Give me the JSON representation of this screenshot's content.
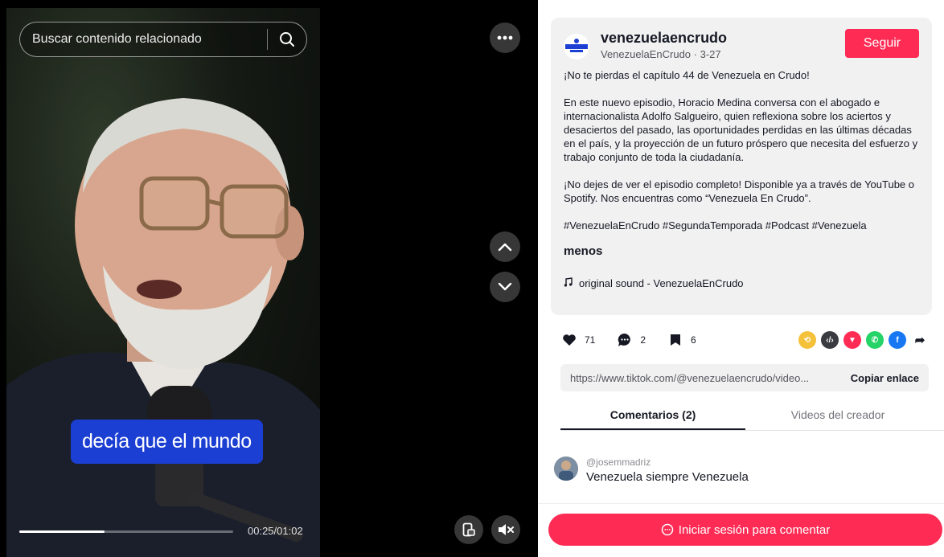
{
  "video": {
    "search_placeholder": "Buscar contenido relacionado",
    "caption": "decía que el mundo",
    "time": "00:25/01:02",
    "progress": 0.4
  },
  "creator": {
    "name": "venezuelaencrudo",
    "meta": "VenezuelaEnCrudo · 3-27",
    "follow_label": "Seguir",
    "avatar_text": "VENEZUELA EN CRUDO"
  },
  "description": {
    "p1": "¡No te pierdas el capítulo 44 de Venezuela en Crudo!",
    "p2": "En este nuevo episodio, Horacio Medina conversa con el abogado e internacionalista Adolfo Salgueiro, quien reflexiona sobre los aciertos y desaciertos del pasado, las oportunidades perdidas en las últimas décadas en el país, y la proyección de un futuro próspero que necesita del esfuerzo y trabajo conjunto de toda la ciudadanía.",
    "p3": "¡No dejes de ver el episodio completo! Disponible ya a través de YouTube o Spotify. Nos encuentras como “Venezuela En Crudo”.",
    "hashtags": "#VenezuelaEnCrudo #SegundaTemporada #Podcast #Venezuela",
    "less_label": "menos",
    "music": "original sound - VenezuelaEnCrudo"
  },
  "stats": {
    "likes": "71",
    "comments": "2",
    "saves": "6"
  },
  "link": {
    "url": "https://www.tiktok.com/@venezuelaencrudo/video...",
    "copy_label": "Copiar enlace"
  },
  "tabs": {
    "comments": "Comentarios (2)",
    "creator_videos": "Videos del creador"
  },
  "comment": {
    "user": "@josemmadriz",
    "text": "Venezuela siempre Venezuela"
  },
  "login_label": "Iniciar sesión para comentar",
  "colors": {
    "accent": "#fe2c55",
    "caption_bg": "#1c3fd3"
  }
}
